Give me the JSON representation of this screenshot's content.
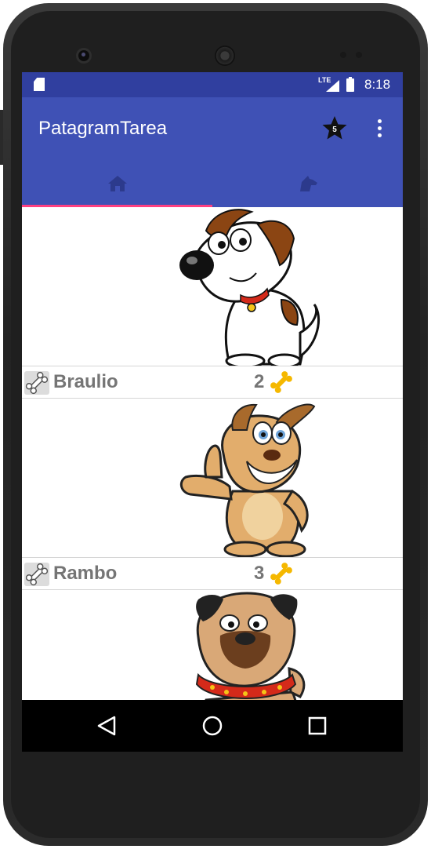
{
  "status_bar": {
    "network": "LTE",
    "time": "8:18"
  },
  "app_bar": {
    "title": "PatagramTarea",
    "favorites_count": "5"
  },
  "tabs": [
    {
      "name": "home-icon"
    },
    {
      "name": "dog-icon"
    }
  ],
  "colors": {
    "primary": "#3f51b5",
    "primary_dark": "#303f9f",
    "accent": "#ff4081",
    "text_gray": "#757575"
  },
  "pets": [
    {
      "name": "Braulio",
      "likes": "2"
    },
    {
      "name": "Rambo",
      "likes": "3"
    },
    {
      "name": "",
      "likes": ""
    }
  ],
  "navigation": [
    {
      "name": "back-button"
    },
    {
      "name": "home-button"
    },
    {
      "name": "recents-button"
    }
  ]
}
